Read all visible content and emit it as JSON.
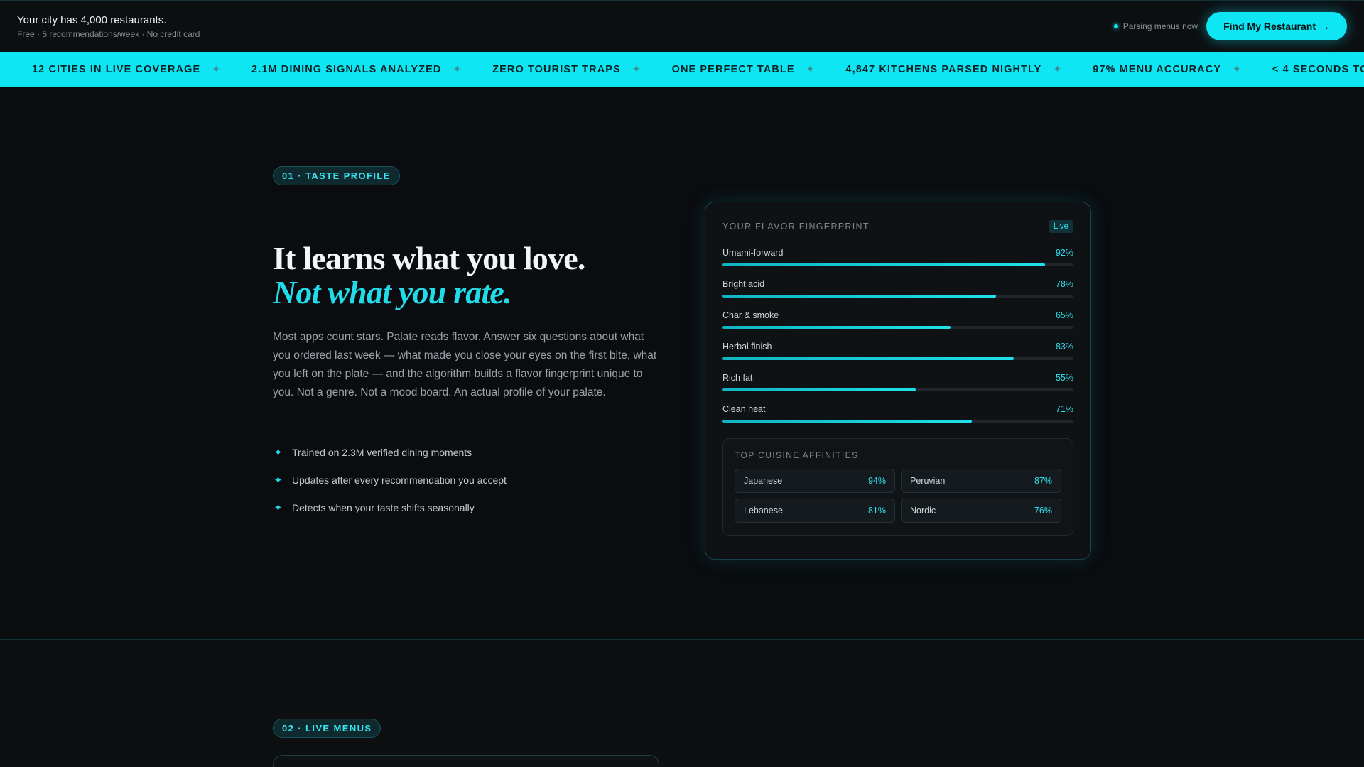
{
  "topbar": {
    "headline": "Your city has 4,000 restaurants.",
    "subline": "Free · 5 recommendations/week · No credit card",
    "status": "Parsing menus now",
    "cta_label": "Find My Restaurant",
    "cta_arrow": "→"
  },
  "ticker": {
    "separator": "✦",
    "items": [
      "12 CITIES IN LIVE COVERAGE",
      "2.1M DINING SIGNALS ANALYZED",
      "ZERO TOURIST TRAPS",
      "ONE PERFECT TABLE",
      "4,847 KITCHENS PARSED NIGHTLY",
      "97% MENU ACCURACY",
      "< 4 SECONDS TO"
    ]
  },
  "section1": {
    "eyebrow": "01 · TASTE PROFILE",
    "headline_line1": "It learns what you love.",
    "headline_line2": "Not what you rate.",
    "body": "Most apps count stars. Palate reads flavor. Answer six questions about what you ordered last week — what made you close your eyes on the first bite, what you left on the plate — and the algorithm builds a flavor fingerprint unique to you. Not a genre. Not a mood board. An actual profile of your palate.",
    "bullets": [
      "Trained on 2.3M verified dining moments",
      "Updates after every recommendation you accept",
      "Detects when your taste shifts seasonally"
    ],
    "bullet_icon": "sparkle-icon"
  },
  "card": {
    "title": "YOUR FLAVOR FINGERPRINT",
    "badge": "Live",
    "flavors": [
      {
        "label": "Umami-forward",
        "value_text": "92%",
        "value": 92
      },
      {
        "label": "Bright acid",
        "value_text": "78%",
        "value": 78
      },
      {
        "label": "Char & smoke",
        "value_text": "65%",
        "value": 65
      },
      {
        "label": "Herbal finish",
        "value_text": "83%",
        "value": 83
      },
      {
        "label": "Rich fat",
        "value_text": "55%",
        "value": 55
      },
      {
        "label": "Clean heat",
        "value_text": "71%",
        "value": 71
      }
    ],
    "affinity_title": "TOP CUISINE AFFINITIES",
    "affinities": [
      {
        "name": "Japanese",
        "value": "94%"
      },
      {
        "name": "Peruvian",
        "value": "87%"
      },
      {
        "name": "Lebanese",
        "value": "81%"
      },
      {
        "name": "Nordic",
        "value": "76%"
      }
    ]
  },
  "section2": {
    "eyebrow": "02 · LIVE MENUS"
  },
  "colors": {
    "accent": "#0ee6f3",
    "background": "#0a0c0f",
    "text_muted": "#9ba2a8"
  }
}
